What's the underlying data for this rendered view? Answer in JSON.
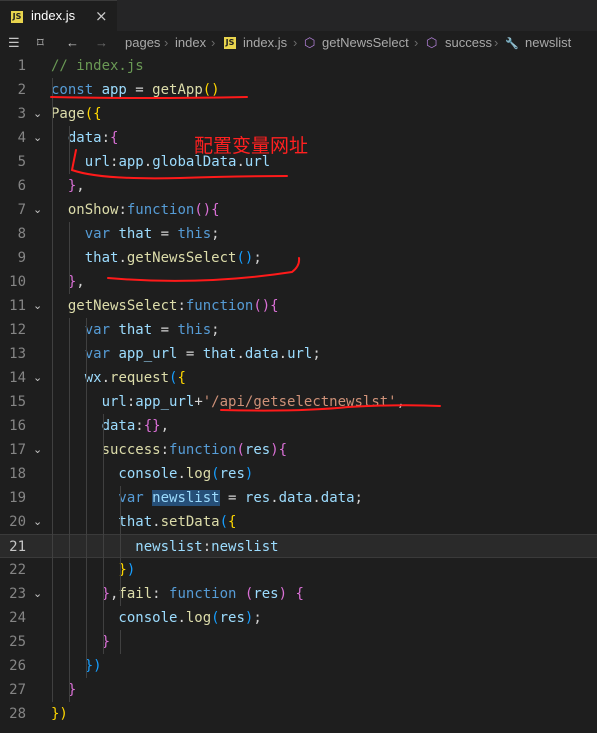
{
  "tab": {
    "label": "index.js",
    "badge": "JS",
    "close": "×"
  },
  "breadcrumb": {
    "items": [
      "pages",
      "index",
      "index.js",
      "getNewsSelect",
      "success",
      "newslist"
    ],
    "seps": [
      "›",
      "›",
      "›",
      "›",
      "›"
    ],
    "icons": {
      "list": "☰",
      "bookmark": "⌑",
      "back": "←",
      "forward": "→",
      "cube": "⬡",
      "wrench": "🔧"
    }
  },
  "editor": {
    "current_line": 21,
    "lines": [
      {
        "n": "1",
        "parts": [
          [
            "// index.js",
            "c"
          ]
        ]
      },
      {
        "n": "2",
        "parts": [
          [
            "const ",
            "k"
          ],
          [
            "app",
            "v"
          ],
          [
            " = ",
            "p"
          ],
          [
            "getApp",
            "f"
          ],
          [
            "()",
            "b1"
          ]
        ]
      },
      {
        "n": "3",
        "parts": [
          [
            "Page",
            "f"
          ],
          [
            "({",
            "b1"
          ]
        ]
      },
      {
        "n": "4",
        "parts": [
          [
            "  data",
            "v"
          ],
          [
            ":",
            "p"
          ],
          [
            "{",
            "b2"
          ]
        ]
      },
      {
        "n": "5",
        "parts": [
          [
            "    url",
            "v"
          ],
          [
            ":",
            "p"
          ],
          [
            "app",
            "v"
          ],
          [
            ".",
            "p"
          ],
          [
            "globalData",
            "v"
          ],
          [
            ".",
            "p"
          ],
          [
            "url",
            "v"
          ]
        ]
      },
      {
        "n": "6",
        "parts": [
          [
            "  }",
            "b2"
          ],
          [
            ",",
            "p"
          ]
        ]
      },
      {
        "n": "7",
        "parts": [
          [
            "  onShow",
            "f"
          ],
          [
            ":",
            "p"
          ],
          [
            "function",
            "k"
          ],
          [
            "()",
            "b2"
          ],
          [
            "{",
            "b2"
          ]
        ]
      },
      {
        "n": "8",
        "parts": [
          [
            "    var ",
            "k"
          ],
          [
            "that",
            "v"
          ],
          [
            " = ",
            "p"
          ],
          [
            "this",
            "k"
          ],
          [
            ";",
            "p"
          ]
        ]
      },
      {
        "n": "9",
        "parts": [
          [
            "    that",
            "v"
          ],
          [
            ".",
            "p"
          ],
          [
            "getNewsSelect",
            "f"
          ],
          [
            "()",
            "b3"
          ],
          [
            ";",
            "p"
          ]
        ]
      },
      {
        "n": "10",
        "parts": [
          [
            "  }",
            "b2"
          ],
          [
            ",",
            "p"
          ]
        ]
      },
      {
        "n": "11",
        "parts": [
          [
            "  getNewsSelect",
            "f"
          ],
          [
            ":",
            "p"
          ],
          [
            "function",
            "k"
          ],
          [
            "()",
            "b2"
          ],
          [
            "{",
            "b2"
          ]
        ]
      },
      {
        "n": "12",
        "parts": [
          [
            "    var ",
            "k"
          ],
          [
            "that",
            "v"
          ],
          [
            " = ",
            "p"
          ],
          [
            "this",
            "k"
          ],
          [
            ";",
            "p"
          ]
        ]
      },
      {
        "n": "13",
        "parts": [
          [
            "    var ",
            "k"
          ],
          [
            "app_url",
            "v"
          ],
          [
            " = ",
            "p"
          ],
          [
            "that",
            "v"
          ],
          [
            ".",
            "p"
          ],
          [
            "data",
            "v"
          ],
          [
            ".",
            "p"
          ],
          [
            "url",
            "v"
          ],
          [
            ";",
            "p"
          ]
        ]
      },
      {
        "n": "14",
        "parts": [
          [
            "    wx",
            "v"
          ],
          [
            ".",
            "p"
          ],
          [
            "request",
            "f"
          ],
          [
            "(",
            "b3"
          ],
          [
            "{",
            "b1"
          ]
        ]
      },
      {
        "n": "15",
        "parts": [
          [
            "      url",
            "v"
          ],
          [
            ":",
            "p"
          ],
          [
            "app_url",
            "v"
          ],
          [
            "+",
            "p"
          ],
          [
            "'/api/getselectnewslst'",
            "s"
          ],
          [
            ",",
            "p"
          ]
        ]
      },
      {
        "n": "16",
        "parts": [
          [
            "      data",
            "v"
          ],
          [
            ":",
            "p"
          ],
          [
            "{}",
            "b2"
          ],
          [
            ",",
            "p"
          ]
        ]
      },
      {
        "n": "17",
        "parts": [
          [
            "      success",
            "f"
          ],
          [
            ":",
            "p"
          ],
          [
            "function",
            "k"
          ],
          [
            "(",
            "b2"
          ],
          [
            "res",
            "v"
          ],
          [
            ")",
            "b2"
          ],
          [
            "{",
            "b2"
          ]
        ]
      },
      {
        "n": "18",
        "parts": [
          [
            "        console",
            "v"
          ],
          [
            ".",
            "p"
          ],
          [
            "log",
            "f"
          ],
          [
            "(",
            "b3"
          ],
          [
            "res",
            "v"
          ],
          [
            ")",
            "b3"
          ]
        ]
      },
      {
        "n": "19",
        "parts": [
          [
            "        var ",
            "k"
          ],
          [
            "newslist",
            "v hl"
          ],
          [
            " = ",
            "p"
          ],
          [
            "res",
            "v"
          ],
          [
            ".",
            "p"
          ],
          [
            "data",
            "v"
          ],
          [
            ".",
            "p"
          ],
          [
            "data",
            "v"
          ],
          [
            ";",
            "p"
          ]
        ]
      },
      {
        "n": "20",
        "parts": [
          [
            "        that",
            "v"
          ],
          [
            ".",
            "p"
          ],
          [
            "setData",
            "f"
          ],
          [
            "(",
            "b3"
          ],
          [
            "{",
            "b1"
          ]
        ]
      },
      {
        "n": "21",
        "parts": [
          [
            "          newslist",
            "v"
          ],
          [
            ":",
            "p"
          ],
          [
            "newslist",
            "v"
          ]
        ]
      },
      {
        "n": "22",
        "parts": [
          [
            "        }",
            "b1"
          ],
          [
            ")",
            "b3"
          ]
        ]
      },
      {
        "n": "23",
        "parts": [
          [
            "      }",
            "b2"
          ],
          [
            ",",
            "p"
          ],
          [
            "fail",
            "f"
          ],
          [
            ": ",
            "p"
          ],
          [
            "function",
            "k"
          ],
          [
            " (",
            "b2"
          ],
          [
            "res",
            "v"
          ],
          [
            ") ",
            "b2"
          ],
          [
            "{",
            "b2"
          ]
        ]
      },
      {
        "n": "24",
        "parts": [
          [
            "        console",
            "v"
          ],
          [
            ".",
            "p"
          ],
          [
            "log",
            "f"
          ],
          [
            "(",
            "b3"
          ],
          [
            "res",
            "v"
          ],
          [
            ")",
            "b3"
          ],
          [
            ";",
            "p"
          ]
        ]
      },
      {
        "n": "25",
        "parts": [
          [
            "      }",
            "b2"
          ]
        ]
      },
      {
        "n": "26",
        "parts": [
          [
            "    })",
            "b3"
          ]
        ]
      },
      {
        "n": "27",
        "parts": [
          [
            "  }",
            "b2"
          ]
        ]
      },
      {
        "n": "28",
        "parts": [
          [
            "})",
            "b1"
          ]
        ]
      }
    ],
    "foldable": [
      "3",
      "4",
      "7",
      "11",
      "14",
      "17",
      "20",
      "23"
    ]
  },
  "annotation": {
    "text": "配置变量网址",
    "color": "#ff2020"
  },
  "colors": {
    "background": "#1e1e1e",
    "keyword": "#569cd6",
    "function": "#dcdcaa",
    "string": "#ce9178",
    "comment": "#6a9955",
    "variable": "#9cdcfe"
  }
}
